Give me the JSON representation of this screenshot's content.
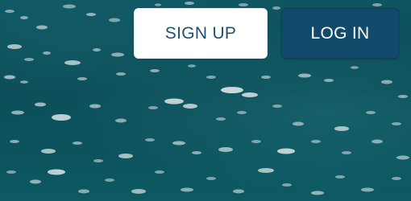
{
  "header": {
    "signup_label": "SIGN UP",
    "login_label": "LOG IN"
  },
  "colors": {
    "signup_bg": "#ffffff",
    "signup_text": "#1f5070",
    "login_bg": "#124a6b",
    "login_text": "#ffffff",
    "background_water": "#0b4f59"
  }
}
